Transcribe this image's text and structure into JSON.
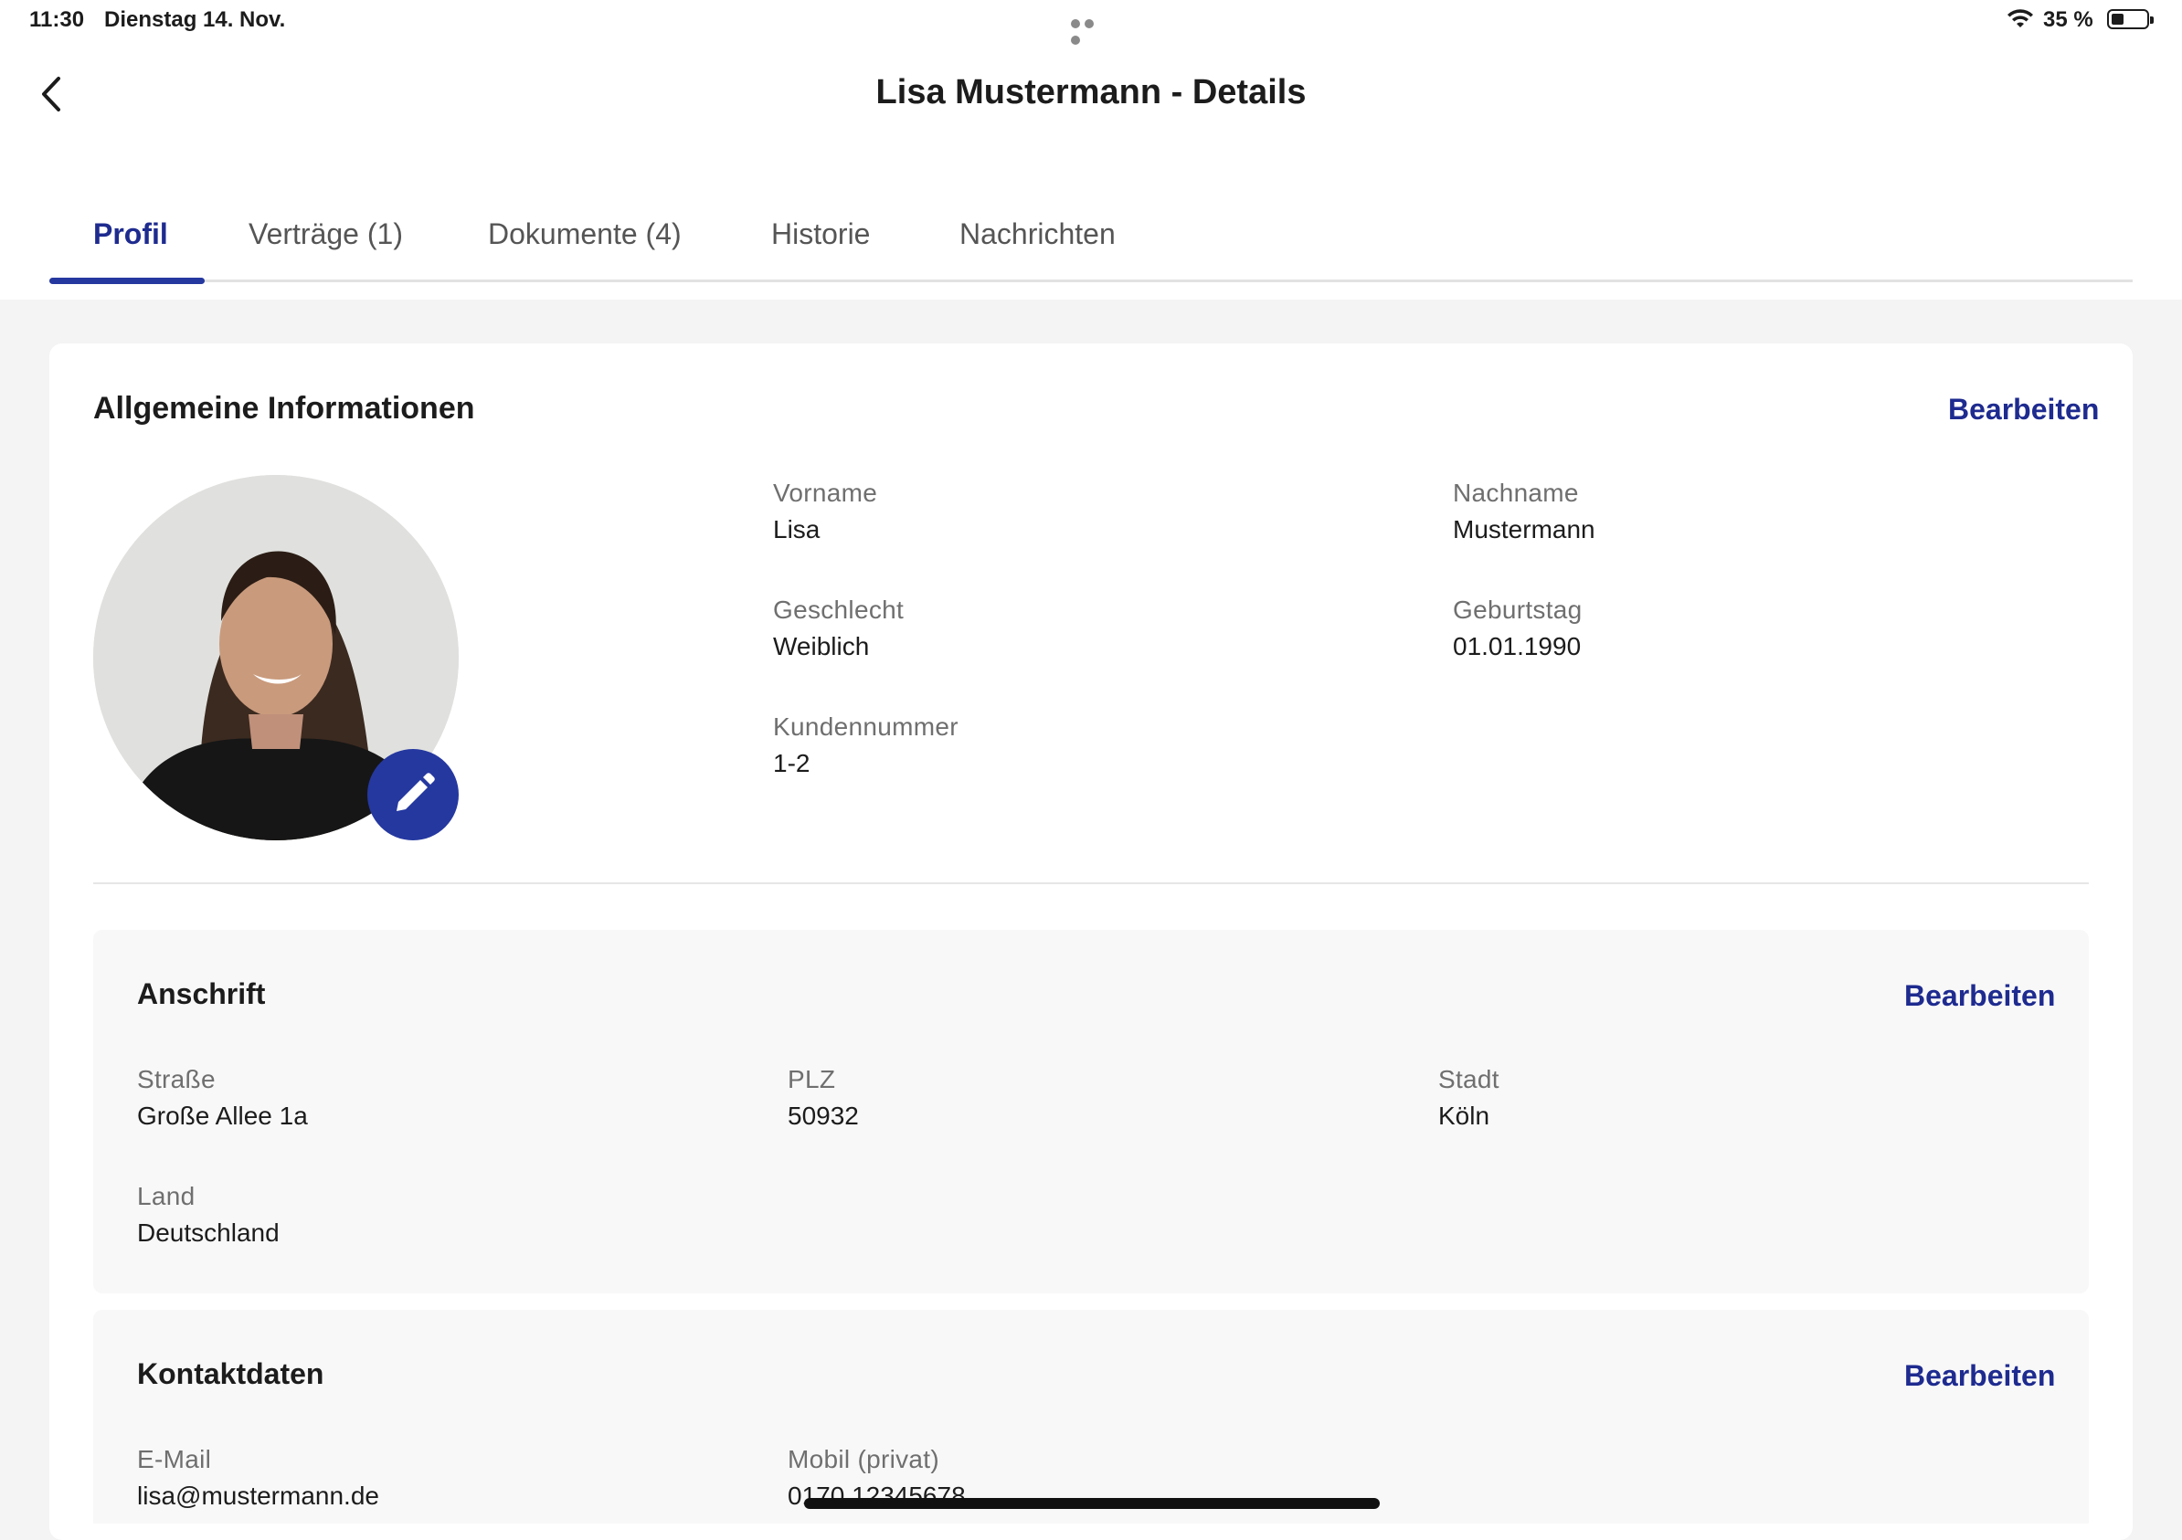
{
  "status_bar": {
    "time": "11:30",
    "date": "Dienstag 14. Nov.",
    "battery_percent": "35 %",
    "battery_level": 0.35
  },
  "header": {
    "title": "Lisa Mustermann - Details",
    "back_icon": "chevron-left-icon"
  },
  "tabs": [
    {
      "label": "Profil",
      "active": true
    },
    {
      "label": "Verträge (1)",
      "active": false
    },
    {
      "label": "Dokumente (4)",
      "active": false
    },
    {
      "label": "Historie",
      "active": false
    },
    {
      "label": "Nachrichten",
      "active": false
    }
  ],
  "general": {
    "title": "Allgemeine Informationen",
    "edit_label": "Bearbeiten",
    "fields": {
      "vorname": {
        "label": "Vorname",
        "value": "Lisa"
      },
      "nachname": {
        "label": "Nachname",
        "value": "Mustermann"
      },
      "geschlecht": {
        "label": "Geschlecht",
        "value": "Weiblich"
      },
      "geburtstag": {
        "label": "Geburtstag",
        "value": "01.01.1990"
      },
      "kundennummer": {
        "label": "Kundennummer",
        "value": "1-2"
      }
    },
    "avatar_edit_icon": "pencil-icon"
  },
  "address": {
    "title": "Anschrift",
    "edit_label": "Bearbeiten",
    "fields": {
      "strasse": {
        "label": "Straße",
        "value": "Große Allee 1a"
      },
      "plz": {
        "label": "PLZ",
        "value": "50932"
      },
      "stadt": {
        "label": "Stadt",
        "value": "Köln"
      },
      "land": {
        "label": "Land",
        "value": "Deutschland"
      }
    }
  },
  "contact": {
    "title": "Kontaktdaten",
    "edit_label": "Bearbeiten",
    "fields": {
      "email": {
        "label": "E-Mail",
        "value": "lisa@mustermann.de"
      },
      "mobil": {
        "label": "Mobil (privat)",
        "value": "0170 12345678"
      }
    }
  },
  "colors": {
    "accent": "#1e2b8f",
    "badge": "#2538a0",
    "background": "#f3f4f3"
  }
}
